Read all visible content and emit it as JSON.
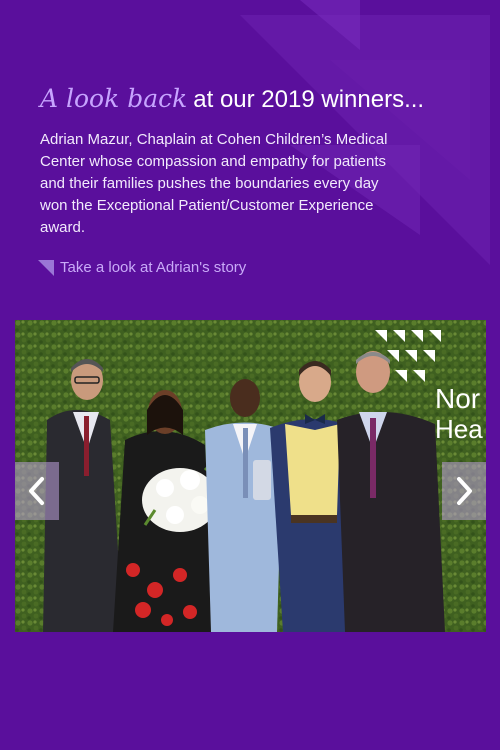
{
  "headline": {
    "accent": "A look back",
    "rest": "at our 2019 winners..."
  },
  "blurb": "Adrian Mazur, Chaplain at Cohen Children’s Medical Center whose compassion and empathy for patients and their families pushes the boundaries every day won the Exceptional Patient/Customer Experience award.",
  "story_link": {
    "label": "Take a look at Adrian's story",
    "icon": "triangle-corner-icon"
  },
  "photo": {
    "alt": "Award winners posing in front of a green hedge wall",
    "sign_text": [
      "Nor",
      "Hea"
    ]
  },
  "carousel": {
    "prev_icon": "chevron-left-icon",
    "next_icon": "chevron-right-icon"
  },
  "colors": {
    "background": "#5a0f9c",
    "accent": "#c7a4ff",
    "link": "#c9aaf8"
  }
}
